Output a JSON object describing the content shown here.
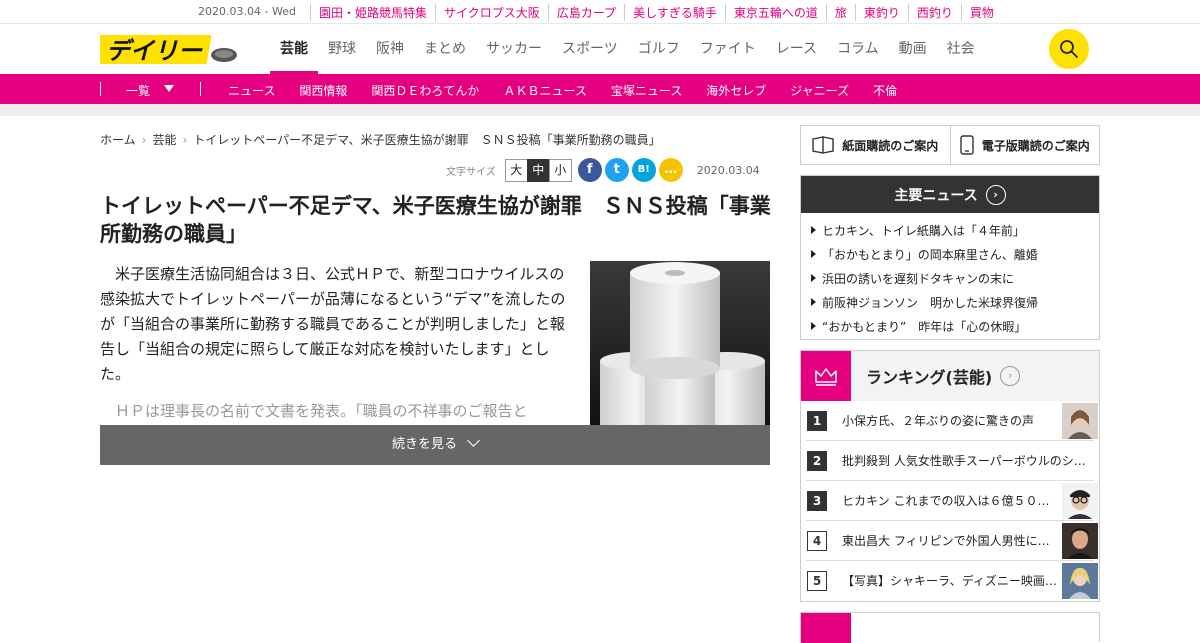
{
  "topbar": {
    "date": "2020.03.04 - Wed",
    "links": [
      "園田・姫路競馬特集",
      "サイクロプス大阪",
      "広島カープ",
      "美しすぎる騎手",
      "東京五輪への道",
      "旅",
      "東釣り",
      "西釣り",
      "買物"
    ]
  },
  "header": {
    "logo_text": "デイリー",
    "nav": [
      "芸能",
      "野球",
      "阪神",
      "まとめ",
      "サッカー",
      "スポーツ",
      "ゴルフ",
      "ファイト",
      "レース",
      "コラム",
      "動画",
      "社会"
    ],
    "active_nav": "芸能",
    "search_icon": "search-icon"
  },
  "subnav": {
    "list_label": "一覧",
    "items": [
      "ニュース",
      "関西情報",
      "関西ＤＥわろてんか",
      "ＡＫＢニュース",
      "宝塚ニュース",
      "海外セレブ",
      "ジャニーズ",
      "不倫"
    ]
  },
  "breadcrumb": [
    "ホーム",
    "芸能",
    "トイレットペーパー不足デマ、米子医療生協が謝罪　ＳＮＳ投稿「事業所勤務の職員」"
  ],
  "tools": {
    "font_size_label": "文字サイズ",
    "sizes": [
      "大",
      "中",
      "小"
    ],
    "selected_size": "中",
    "share": [
      {
        "icon": "facebook-icon",
        "glyph": "f",
        "color": "#3b5998"
      },
      {
        "icon": "twitter-icon",
        "glyph": "t",
        "color": "#1da1f2"
      },
      {
        "icon": "hatena-bookmark-icon",
        "glyph": "B!",
        "color": "#00a4de"
      },
      {
        "icon": "comment-icon",
        "glyph": "…",
        "color": "#f5c400"
      }
    ],
    "date": "2020.03.04"
  },
  "article": {
    "headline": "トイレットペーパー不足デマ、米子医療生協が謝罪　ＳＮＳ投稿「事業所勤務の職員」",
    "paragraph1": "米子医療生活協同組合は３日、公式ＨＰで、新型コロナウイルスの感染拡大でトイレットペーパーが品薄になるという“デマ”を流したのが「当組合の事業所に勤務する職員であることが判明しました」と報告し「当組合の規定に照らして厳正な対応を検討いたします」とした。",
    "paragraph2": "ＨＰは理事長の名前で文書を発表。「職員の不祥事のご報告と",
    "more_label": "続きを見る"
  },
  "sidebar": {
    "subscribe": [
      {
        "icon": "newspaper-icon",
        "label": "紙面購読のご案内"
      },
      {
        "icon": "smartphone-icon",
        "label": "電子版購読のご案内"
      }
    ],
    "main_news": {
      "title": "主要ニュース",
      "items": [
        "ヒカキン、トイレ紙購入は「４年前」",
        "「おかもとまり」の岡本麻里さん、離婚",
        "浜田の誘いを遅刻ドタキャンの末に",
        "前阪神ジョンソン　明かした米球界復帰",
        "“おかもとまり”　昨年は「心の休暇」"
      ]
    },
    "ranking": {
      "title": "ランキング(芸能)",
      "items": [
        {
          "rank": "1",
          "text": "小保方氏、２年ぶりの姿に驚きの声"
        },
        {
          "rank": "2",
          "text": "批判殺到 人気女性歌手スーパーボウルのシ…"
        },
        {
          "rank": "3",
          "text": "ヒカキン これまでの収入は６億５０…"
        },
        {
          "rank": "4",
          "text": "東出昌大 フィリピンで外国人男性に…"
        },
        {
          "rank": "5",
          "text": "【写真】シャキーラ、ディズニー映画…"
        }
      ]
    }
  },
  "colors": {
    "brand_pink": "#e4007f",
    "brand_yellow": "#ffe100",
    "dark": "#333333"
  }
}
